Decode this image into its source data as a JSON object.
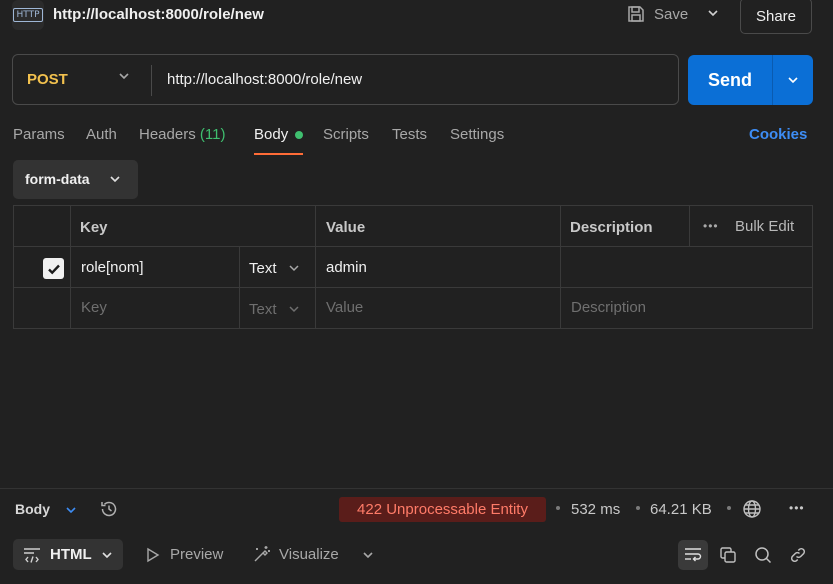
{
  "header": {
    "request_title": "http://localhost:8000/role/new",
    "http_icon_label": "HTTP",
    "save_label": "Save",
    "share_label": "Share"
  },
  "request": {
    "method": "POST",
    "url": "http://localhost:8000/role/new",
    "send_label": "Send"
  },
  "tabs": {
    "params": "Params",
    "auth": "Auth",
    "headers": "Headers",
    "headers_count": "(11)",
    "body": "Body",
    "scripts": "Scripts",
    "tests": "Tests",
    "settings": "Settings",
    "active": "Body",
    "cookies": "Cookies"
  },
  "body_mode": "form-data",
  "table": {
    "columns": {
      "key": "Key",
      "value": "Value",
      "description": "Description"
    },
    "bulk_edit": "Bulk Edit",
    "rows": [
      {
        "checked": true,
        "key": "role[nom]",
        "type": "Text",
        "value": "admin",
        "description": ""
      }
    ],
    "placeholder": {
      "key": "Key",
      "type": "Text",
      "value": "Value",
      "description": "Description"
    }
  },
  "response": {
    "section_label": "Body",
    "status": "422 Unprocessable Entity",
    "time": "532 ms",
    "size": "64.21 KB",
    "format": "HTML",
    "preview_label": "Preview",
    "visualize_label": "Visualize"
  },
  "colors": {
    "background": "#212121",
    "method": "#f2c14e",
    "send": "#0b6fd6",
    "active_tab_underline": "#ff6c37",
    "body_dot": "#3fbf6f",
    "cookies": "#3d8df5",
    "status_error_bg": "#5a1d1a",
    "status_error_text": "#ff7b68"
  },
  "icons": [
    "http-icon",
    "save-icon",
    "chevron-down-icon",
    "check-icon",
    "more-horizontal-icon",
    "history-icon",
    "globe-icon",
    "code-icon",
    "play-icon",
    "visualize-icon",
    "wrap-lines-icon",
    "copy-icon",
    "search-icon",
    "link-icon"
  ]
}
